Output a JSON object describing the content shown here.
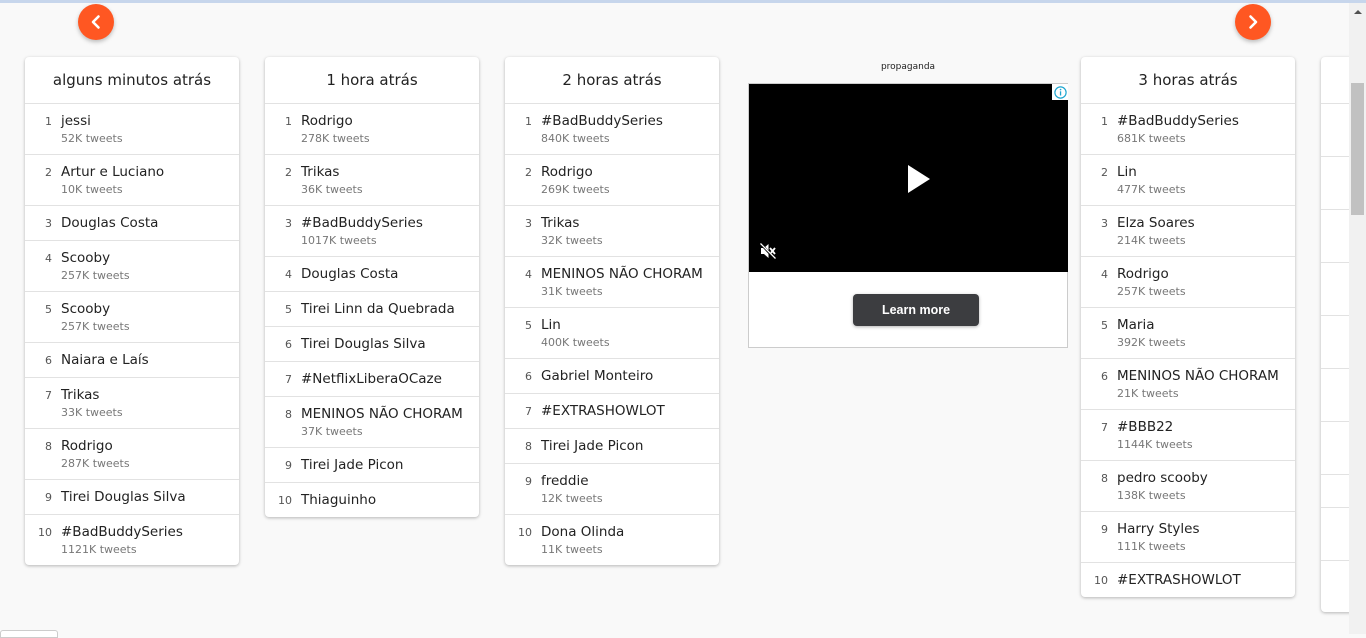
{
  "navigation": {
    "prev_icon": "chevron-left-icon",
    "next_icon": "chevron-right-icon",
    "accent_color": "#ff5722"
  },
  "columns": [
    {
      "title": "alguns minutos atrás",
      "trends": [
        {
          "rank": "1",
          "name": "jessi",
          "count": "52K tweets"
        },
        {
          "rank": "2",
          "name": "Artur e Luciano",
          "count": "10K tweets"
        },
        {
          "rank": "3",
          "name": "Douglas Costa",
          "count": ""
        },
        {
          "rank": "4",
          "name": "Scooby",
          "count": "257K tweets"
        },
        {
          "rank": "5",
          "name": "Scooby",
          "count": "257K tweets"
        },
        {
          "rank": "6",
          "name": "Naiara e Laís",
          "count": ""
        },
        {
          "rank": "7",
          "name": "Trikas",
          "count": "33K tweets"
        },
        {
          "rank": "8",
          "name": "Rodrigo",
          "count": "287K tweets"
        },
        {
          "rank": "9",
          "name": "Tirei Douglas Silva",
          "count": ""
        },
        {
          "rank": "10",
          "name": "#BadBuddySeries",
          "count": "1121K tweets"
        }
      ]
    },
    {
      "title": "1 hora atrás",
      "trends": [
        {
          "rank": "1",
          "name": "Rodrigo",
          "count": "278K tweets"
        },
        {
          "rank": "2",
          "name": "Trikas",
          "count": "36K tweets"
        },
        {
          "rank": "3",
          "name": "#BadBuddySeries",
          "count": "1017K tweets"
        },
        {
          "rank": "4",
          "name": "Douglas Costa",
          "count": ""
        },
        {
          "rank": "5",
          "name": "Tirei Linn da Quebrada",
          "count": ""
        },
        {
          "rank": "6",
          "name": "Tirei Douglas Silva",
          "count": ""
        },
        {
          "rank": "7",
          "name": "#NetflixLiberaOCaze",
          "count": ""
        },
        {
          "rank": "8",
          "name": "MENINOS NÃO CHORAM",
          "count": "37K tweets"
        },
        {
          "rank": "9",
          "name": "Tirei Jade Picon",
          "count": ""
        },
        {
          "rank": "10",
          "name": "Thiaguinho",
          "count": ""
        }
      ]
    },
    {
      "title": "2 horas atrás",
      "trends": [
        {
          "rank": "1",
          "name": "#BadBuddySeries",
          "count": "840K tweets"
        },
        {
          "rank": "2",
          "name": "Rodrigo",
          "count": "269K tweets"
        },
        {
          "rank": "3",
          "name": "Trikas",
          "count": "32K tweets"
        },
        {
          "rank": "4",
          "name": "MENINOS NÃO CHORAM",
          "count": "31K tweets"
        },
        {
          "rank": "5",
          "name": "Lin",
          "count": "400K tweets"
        },
        {
          "rank": "6",
          "name": "Gabriel Monteiro",
          "count": ""
        },
        {
          "rank": "7",
          "name": "#EXTRASHOWLOT",
          "count": ""
        },
        {
          "rank": "8",
          "name": "Tirei Jade Picon",
          "count": ""
        },
        {
          "rank": "9",
          "name": "freddie",
          "count": "12K tweets"
        },
        {
          "rank": "10",
          "name": "Dona Olinda",
          "count": "11K tweets"
        }
      ]
    },
    {
      "title": "3 horas atrás",
      "trends": [
        {
          "rank": "1",
          "name": "#BadBuddySeries",
          "count": "681K tweets"
        },
        {
          "rank": "2",
          "name": "Lin",
          "count": "477K tweets"
        },
        {
          "rank": "3",
          "name": "Elza Soares",
          "count": "214K tweets"
        },
        {
          "rank": "4",
          "name": "Rodrigo",
          "count": "257K tweets"
        },
        {
          "rank": "5",
          "name": "Maria",
          "count": "392K tweets"
        },
        {
          "rank": "6",
          "name": "MENINOS NÃO CHORAM",
          "count": "21K tweets"
        },
        {
          "rank": "7",
          "name": "#BBB22",
          "count": "1144K tweets"
        },
        {
          "rank": "8",
          "name": "pedro scooby",
          "count": "138K tweets"
        },
        {
          "rank": "9",
          "name": "Harry Styles",
          "count": "111K tweets"
        },
        {
          "rank": "10",
          "name": "#EXTRASHOWLOT",
          "count": ""
        }
      ]
    }
  ],
  "ad": {
    "label": "propaganda",
    "learn_more": "Learn more",
    "info_icon": "info-icon",
    "play_icon": "play-icon",
    "mute_icon": "muted-speaker-icon"
  }
}
